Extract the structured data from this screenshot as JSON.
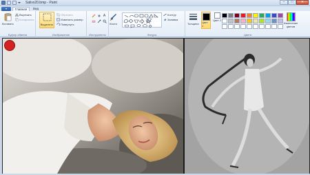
{
  "window": {
    "title": "Salivs20.bmp - Paint",
    "controls": {
      "minimize": "–",
      "maximize": "□",
      "close": "✕"
    }
  },
  "tabs": [
    {
      "label": "Главная"
    },
    {
      "label": "Вид"
    }
  ],
  "app_menu": {
    "label": "▾"
  },
  "clipboard": {
    "paste_label": "Вставить",
    "cut_label": "Вырезать",
    "copy_label": "Копировать",
    "group_label": "Буфер обмена"
  },
  "image": {
    "select_label": "Выделить",
    "crop_label": "Обрезать",
    "resize_label": "Изменить размер",
    "rotate_label": "Повернуть",
    "group_label": "Изображение"
  },
  "tools": {
    "group_label": "Инструменты",
    "text_tool": "A"
  },
  "brushes": {
    "label": "Кисти"
  },
  "shapes": {
    "outline_label": "Контур",
    "fill_label": "Заливка",
    "group_label": "Фигуры"
  },
  "colors": {
    "thickness_label": "Толщина",
    "color1_label": "Цвет 1",
    "color2_label": "Цвет 2",
    "edit_colors_label": "Изменение цветов",
    "group_label": "Цвета",
    "color1_value": "#000000",
    "color2_value": "#ffffff",
    "palette": [
      "#000000",
      "#7f7f7f",
      "#880015",
      "#ed1c24",
      "#ff7f27",
      "#fff200",
      "#22b14c",
      "#00a2e8",
      "#3f48cc",
      "#a349a4",
      "#ffffff",
      "#c3c3c3",
      "#b97a57",
      "#ffaec9",
      "#ffc90e",
      "#efe4b0",
      "#b5e61d",
      "#99d9ea",
      "#7092be",
      "#c8bfe7",
      "#ffffff",
      "#ffffff",
      "#ffffff",
      "#ffffff",
      "#ffffff",
      "#ffffff",
      "#ffffff",
      "#ffffff",
      "#ffffff",
      "#ffffff"
    ]
  }
}
